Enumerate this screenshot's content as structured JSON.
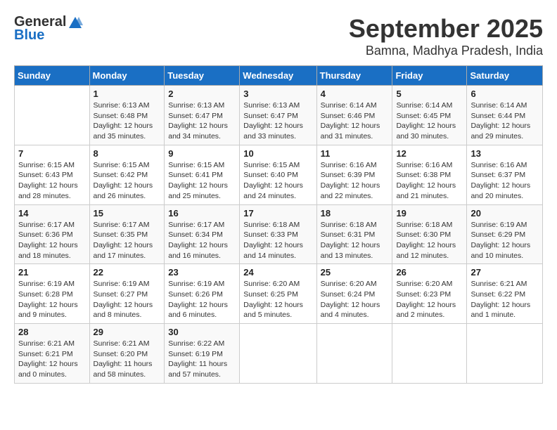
{
  "logo": {
    "general": "General",
    "blue": "Blue"
  },
  "title": "September 2025",
  "location": "Bamna, Madhya Pradesh, India",
  "days_of_week": [
    "Sunday",
    "Monday",
    "Tuesday",
    "Wednesday",
    "Thursday",
    "Friday",
    "Saturday"
  ],
  "weeks": [
    [
      {
        "day": "",
        "info": ""
      },
      {
        "day": "1",
        "info": "Sunrise: 6:13 AM\nSunset: 6:48 PM\nDaylight: 12 hours\nand 35 minutes."
      },
      {
        "day": "2",
        "info": "Sunrise: 6:13 AM\nSunset: 6:47 PM\nDaylight: 12 hours\nand 34 minutes."
      },
      {
        "day": "3",
        "info": "Sunrise: 6:13 AM\nSunset: 6:47 PM\nDaylight: 12 hours\nand 33 minutes."
      },
      {
        "day": "4",
        "info": "Sunrise: 6:14 AM\nSunset: 6:46 PM\nDaylight: 12 hours\nand 31 minutes."
      },
      {
        "day": "5",
        "info": "Sunrise: 6:14 AM\nSunset: 6:45 PM\nDaylight: 12 hours\nand 30 minutes."
      },
      {
        "day": "6",
        "info": "Sunrise: 6:14 AM\nSunset: 6:44 PM\nDaylight: 12 hours\nand 29 minutes."
      }
    ],
    [
      {
        "day": "7",
        "info": "Sunrise: 6:15 AM\nSunset: 6:43 PM\nDaylight: 12 hours\nand 28 minutes."
      },
      {
        "day": "8",
        "info": "Sunrise: 6:15 AM\nSunset: 6:42 PM\nDaylight: 12 hours\nand 26 minutes."
      },
      {
        "day": "9",
        "info": "Sunrise: 6:15 AM\nSunset: 6:41 PM\nDaylight: 12 hours\nand 25 minutes."
      },
      {
        "day": "10",
        "info": "Sunrise: 6:15 AM\nSunset: 6:40 PM\nDaylight: 12 hours\nand 24 minutes."
      },
      {
        "day": "11",
        "info": "Sunrise: 6:16 AM\nSunset: 6:39 PM\nDaylight: 12 hours\nand 22 minutes."
      },
      {
        "day": "12",
        "info": "Sunrise: 6:16 AM\nSunset: 6:38 PM\nDaylight: 12 hours\nand 21 minutes."
      },
      {
        "day": "13",
        "info": "Sunrise: 6:16 AM\nSunset: 6:37 PM\nDaylight: 12 hours\nand 20 minutes."
      }
    ],
    [
      {
        "day": "14",
        "info": "Sunrise: 6:17 AM\nSunset: 6:36 PM\nDaylight: 12 hours\nand 18 minutes."
      },
      {
        "day": "15",
        "info": "Sunrise: 6:17 AM\nSunset: 6:35 PM\nDaylight: 12 hours\nand 17 minutes."
      },
      {
        "day": "16",
        "info": "Sunrise: 6:17 AM\nSunset: 6:34 PM\nDaylight: 12 hours\nand 16 minutes."
      },
      {
        "day": "17",
        "info": "Sunrise: 6:18 AM\nSunset: 6:33 PM\nDaylight: 12 hours\nand 14 minutes."
      },
      {
        "day": "18",
        "info": "Sunrise: 6:18 AM\nSunset: 6:31 PM\nDaylight: 12 hours\nand 13 minutes."
      },
      {
        "day": "19",
        "info": "Sunrise: 6:18 AM\nSunset: 6:30 PM\nDaylight: 12 hours\nand 12 minutes."
      },
      {
        "day": "20",
        "info": "Sunrise: 6:19 AM\nSunset: 6:29 PM\nDaylight: 12 hours\nand 10 minutes."
      }
    ],
    [
      {
        "day": "21",
        "info": "Sunrise: 6:19 AM\nSunset: 6:28 PM\nDaylight: 12 hours\nand 9 minutes."
      },
      {
        "day": "22",
        "info": "Sunrise: 6:19 AM\nSunset: 6:27 PM\nDaylight: 12 hours\nand 8 minutes."
      },
      {
        "day": "23",
        "info": "Sunrise: 6:19 AM\nSunset: 6:26 PM\nDaylight: 12 hours\nand 6 minutes."
      },
      {
        "day": "24",
        "info": "Sunrise: 6:20 AM\nSunset: 6:25 PM\nDaylight: 12 hours\nand 5 minutes."
      },
      {
        "day": "25",
        "info": "Sunrise: 6:20 AM\nSunset: 6:24 PM\nDaylight: 12 hours\nand 4 minutes."
      },
      {
        "day": "26",
        "info": "Sunrise: 6:20 AM\nSunset: 6:23 PM\nDaylight: 12 hours\nand 2 minutes."
      },
      {
        "day": "27",
        "info": "Sunrise: 6:21 AM\nSunset: 6:22 PM\nDaylight: 12 hours\nand 1 minute."
      }
    ],
    [
      {
        "day": "28",
        "info": "Sunrise: 6:21 AM\nSunset: 6:21 PM\nDaylight: 12 hours\nand 0 minutes."
      },
      {
        "day": "29",
        "info": "Sunrise: 6:21 AM\nSunset: 6:20 PM\nDaylight: 11 hours\nand 58 minutes."
      },
      {
        "day": "30",
        "info": "Sunrise: 6:22 AM\nSunset: 6:19 PM\nDaylight: 11 hours\nand 57 minutes."
      },
      {
        "day": "",
        "info": ""
      },
      {
        "day": "",
        "info": ""
      },
      {
        "day": "",
        "info": ""
      },
      {
        "day": "",
        "info": ""
      }
    ]
  ]
}
